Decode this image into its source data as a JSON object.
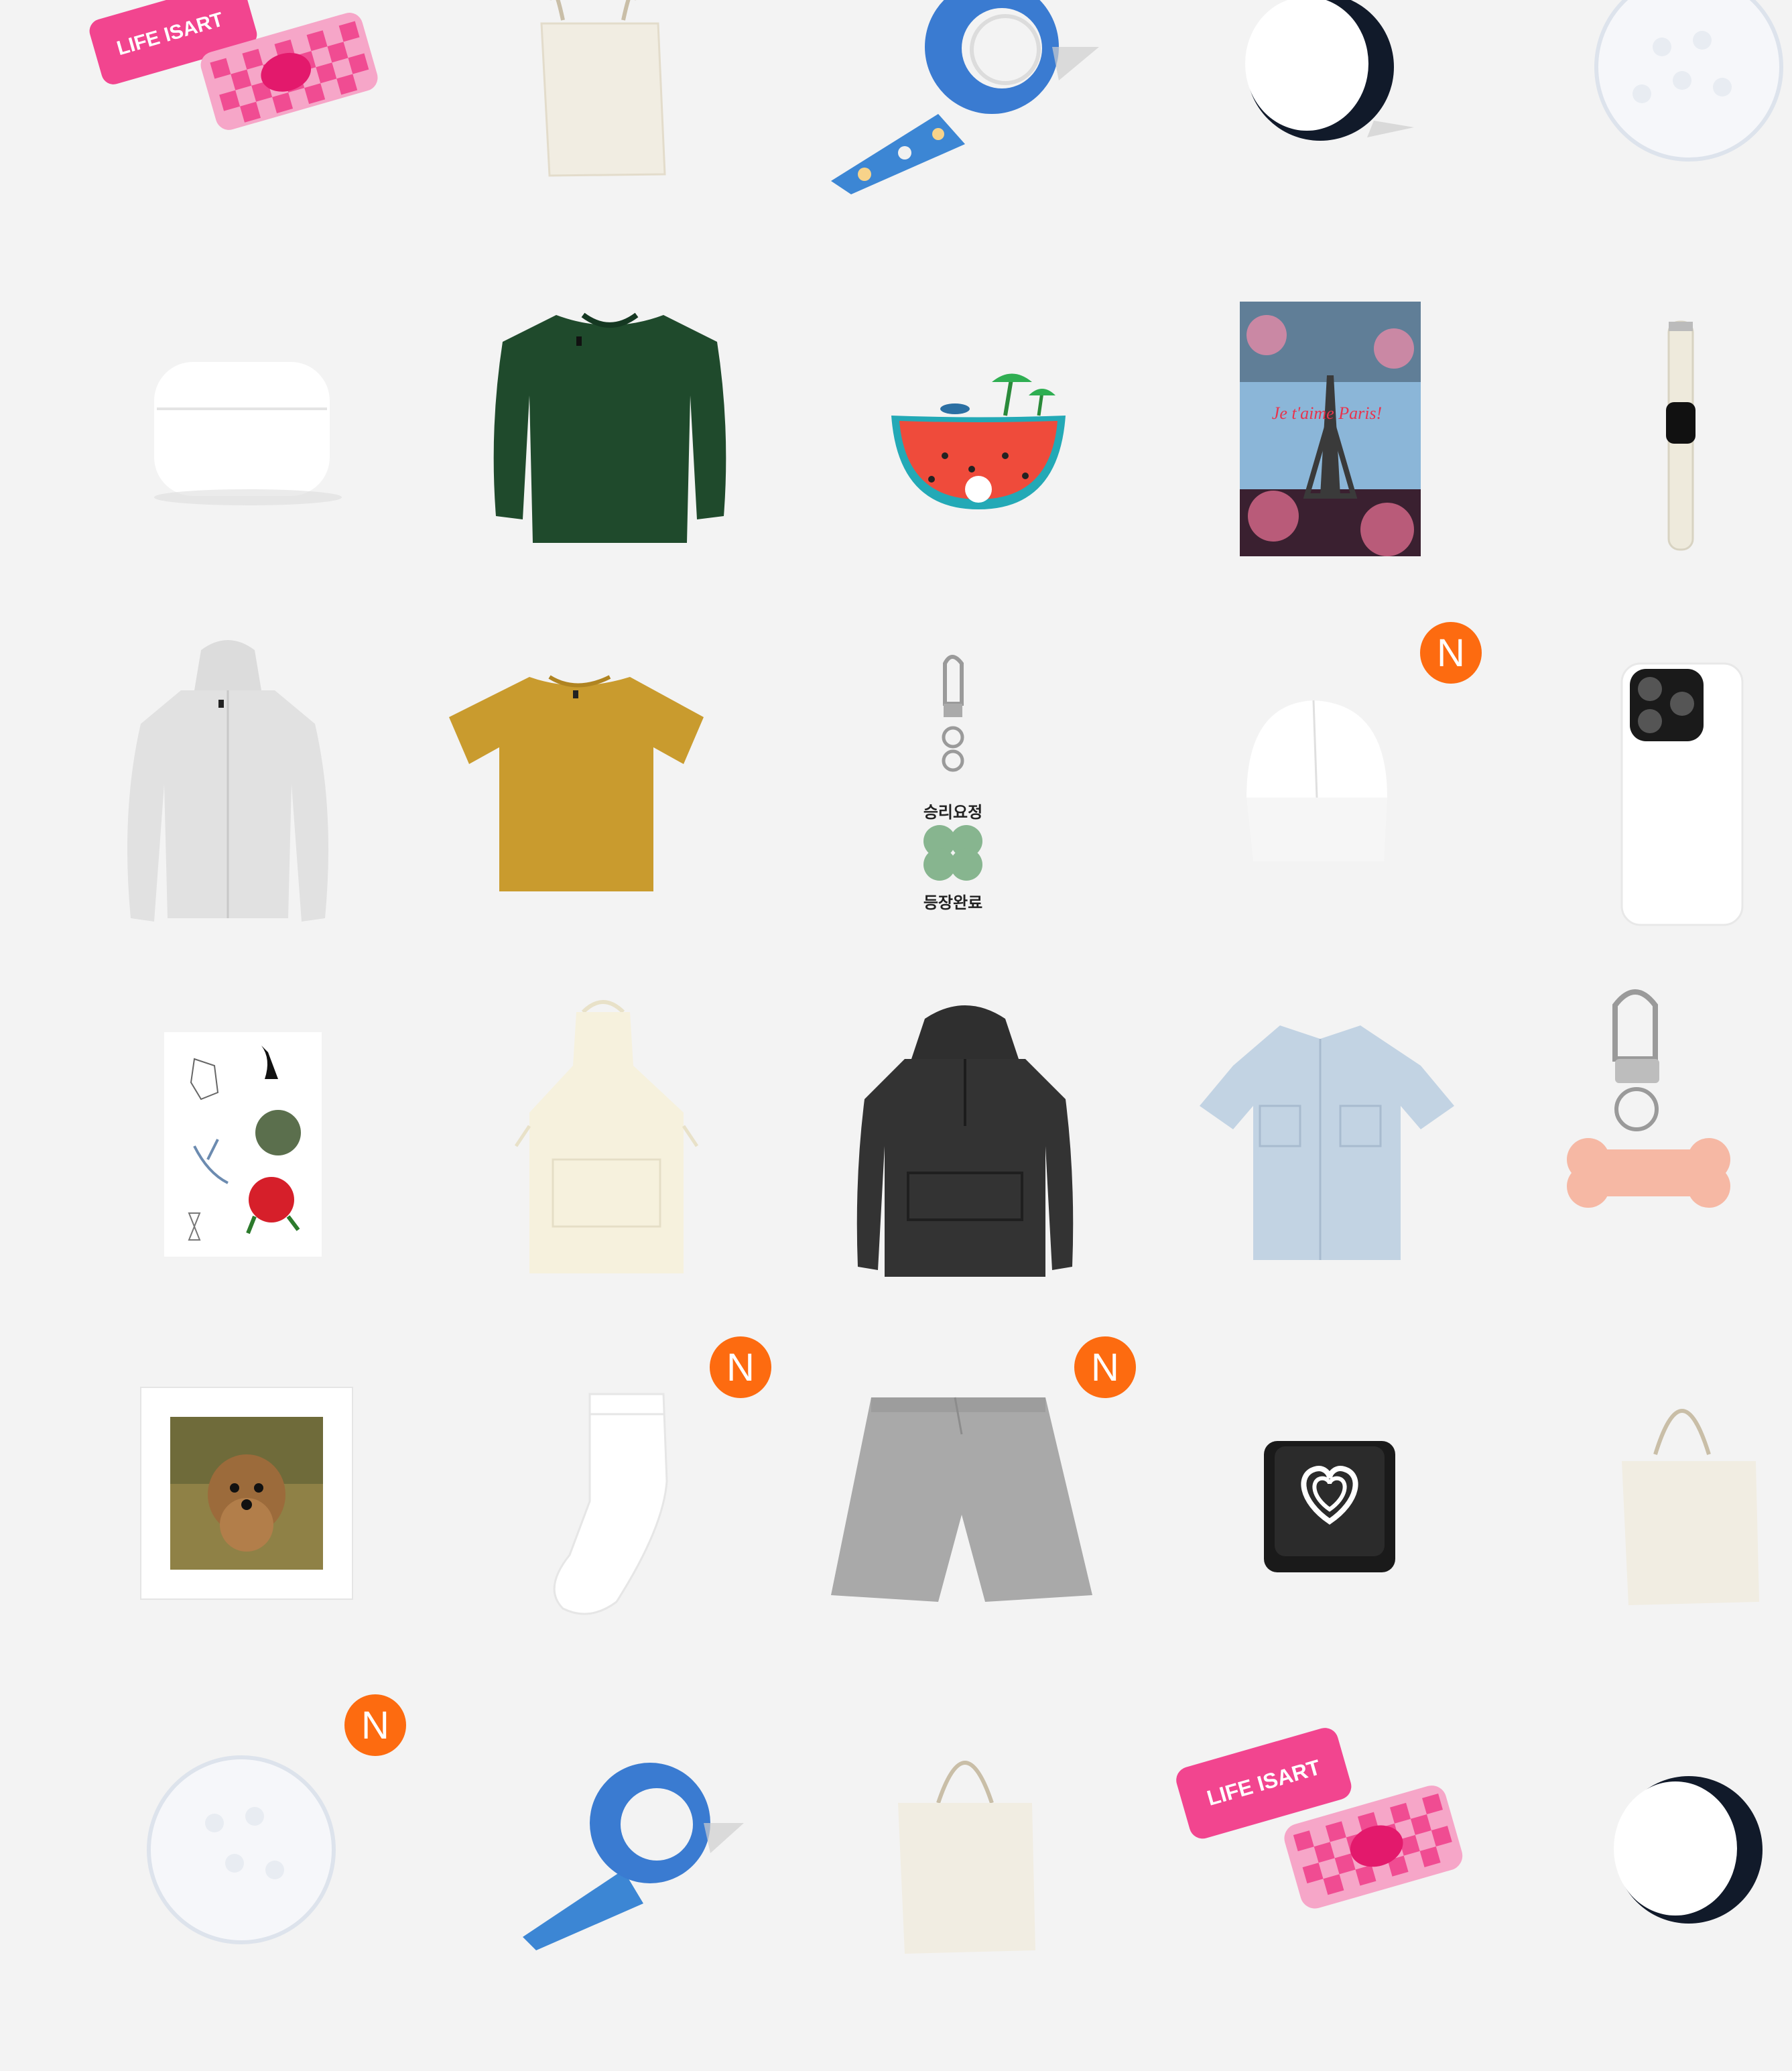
{
  "products": [
    {
      "name": "mint-tin-case",
      "label": "LIFE ISART",
      "new": false
    },
    {
      "name": "eco-bag",
      "new": false
    },
    {
      "name": "masking-tape",
      "new": false
    },
    {
      "name": "smart-grip",
      "new": false
    },
    {
      "name": "golf-ball",
      "new": false
    },
    {
      "name": "airpods-case",
      "new": false
    },
    {
      "name": "sweatshirt-green",
      "new": false
    },
    {
      "name": "acrylic-sticker-watermelon",
      "new": false
    },
    {
      "name": "poster-paris",
      "label": "Je t'aime Paris!",
      "new": false
    },
    {
      "name": "watch-strap",
      "new": false
    },
    {
      "name": "zip-hoodie",
      "new": false
    },
    {
      "name": "t-shirt-mustard",
      "new": false
    },
    {
      "name": "acrylic-keyring-clover",
      "top_text": "승리요정",
      "bottom_text": "등장완료",
      "new": false
    },
    {
      "name": "cap-white",
      "new": true
    },
    {
      "name": "phone-case",
      "new": false
    },
    {
      "name": "tattoo-sticker",
      "new": false
    },
    {
      "name": "apron",
      "new": false
    },
    {
      "name": "anorak",
      "new": false
    },
    {
      "name": "short-sleeve-shirt",
      "new": false
    },
    {
      "name": "pet-tag-keyring",
      "new": false
    },
    {
      "name": "photo-print",
      "new": false
    },
    {
      "name": "socks",
      "new": true
    },
    {
      "name": "shorts-gray",
      "new": true
    },
    {
      "name": "keycap-heart",
      "new": false
    },
    {
      "name": "eco-bag-2",
      "new": false
    },
    {
      "name": "golf-ball-2",
      "new": true
    },
    {
      "name": "masking-tape-2",
      "new": false
    },
    {
      "name": "eco-bag-3",
      "new": false
    },
    {
      "name": "mint-tin-case-2",
      "label": "LIFE ISART",
      "new": false
    },
    {
      "name": "smart-grip-2",
      "new": false
    }
  ],
  "badge_text": "N",
  "colors": {
    "background": "#f3f3f3",
    "badge": "#fd6b10"
  }
}
